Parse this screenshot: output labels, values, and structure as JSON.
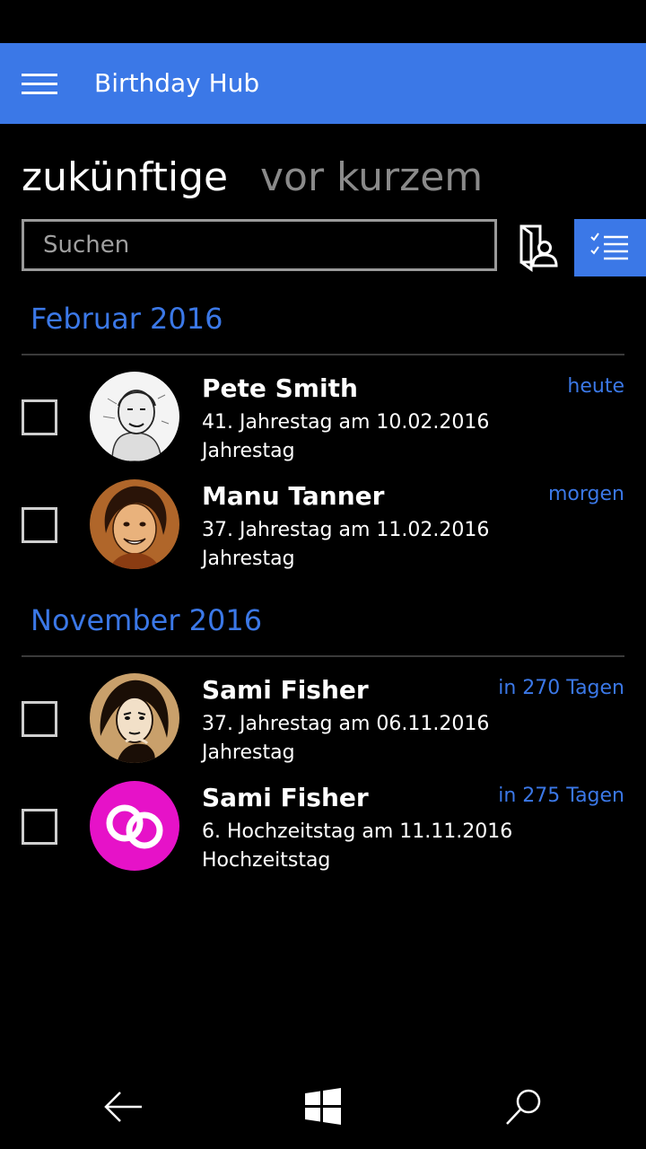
{
  "app": {
    "title": "Birthday Hub"
  },
  "pivot": {
    "tabs": [
      {
        "label": "zukünftige"
      },
      {
        "label": "vor kurzem"
      }
    ]
  },
  "search": {
    "placeholder": "Suchen",
    "value": ""
  },
  "colors": {
    "accent": "#3b78e7",
    "background": "#000000"
  },
  "icons": {
    "menu": "hamburger-icon",
    "contacts": "contact-book-icon",
    "multi_select": "checklist-icon",
    "back": "back-arrow-icon",
    "start": "windows-logo-icon",
    "search": "search-icon"
  },
  "sections": [
    {
      "header": "Februar 2016",
      "items": [
        {
          "name": "Pete Smith",
          "detail": "41. Jahrestag am 10.02.2016",
          "type": "Jahrestag",
          "when": "heute"
        },
        {
          "name": "Manu Tanner",
          "detail": "37. Jahrestag am 11.02.2016",
          "type": "Jahrestag",
          "when": "morgen"
        }
      ]
    },
    {
      "header": "November 2016",
      "items": [
        {
          "name": "Sami Fisher",
          "detail": "37. Jahrestag am 06.11.2016",
          "type": "Jahrestag",
          "when": "in 270 Tagen"
        },
        {
          "name": "Sami Fisher",
          "detail": "6. Hochzeitstag am 11.11.2016",
          "type": "Hochzeitstag",
          "when": "in 275 Tagen"
        }
      ]
    }
  ]
}
